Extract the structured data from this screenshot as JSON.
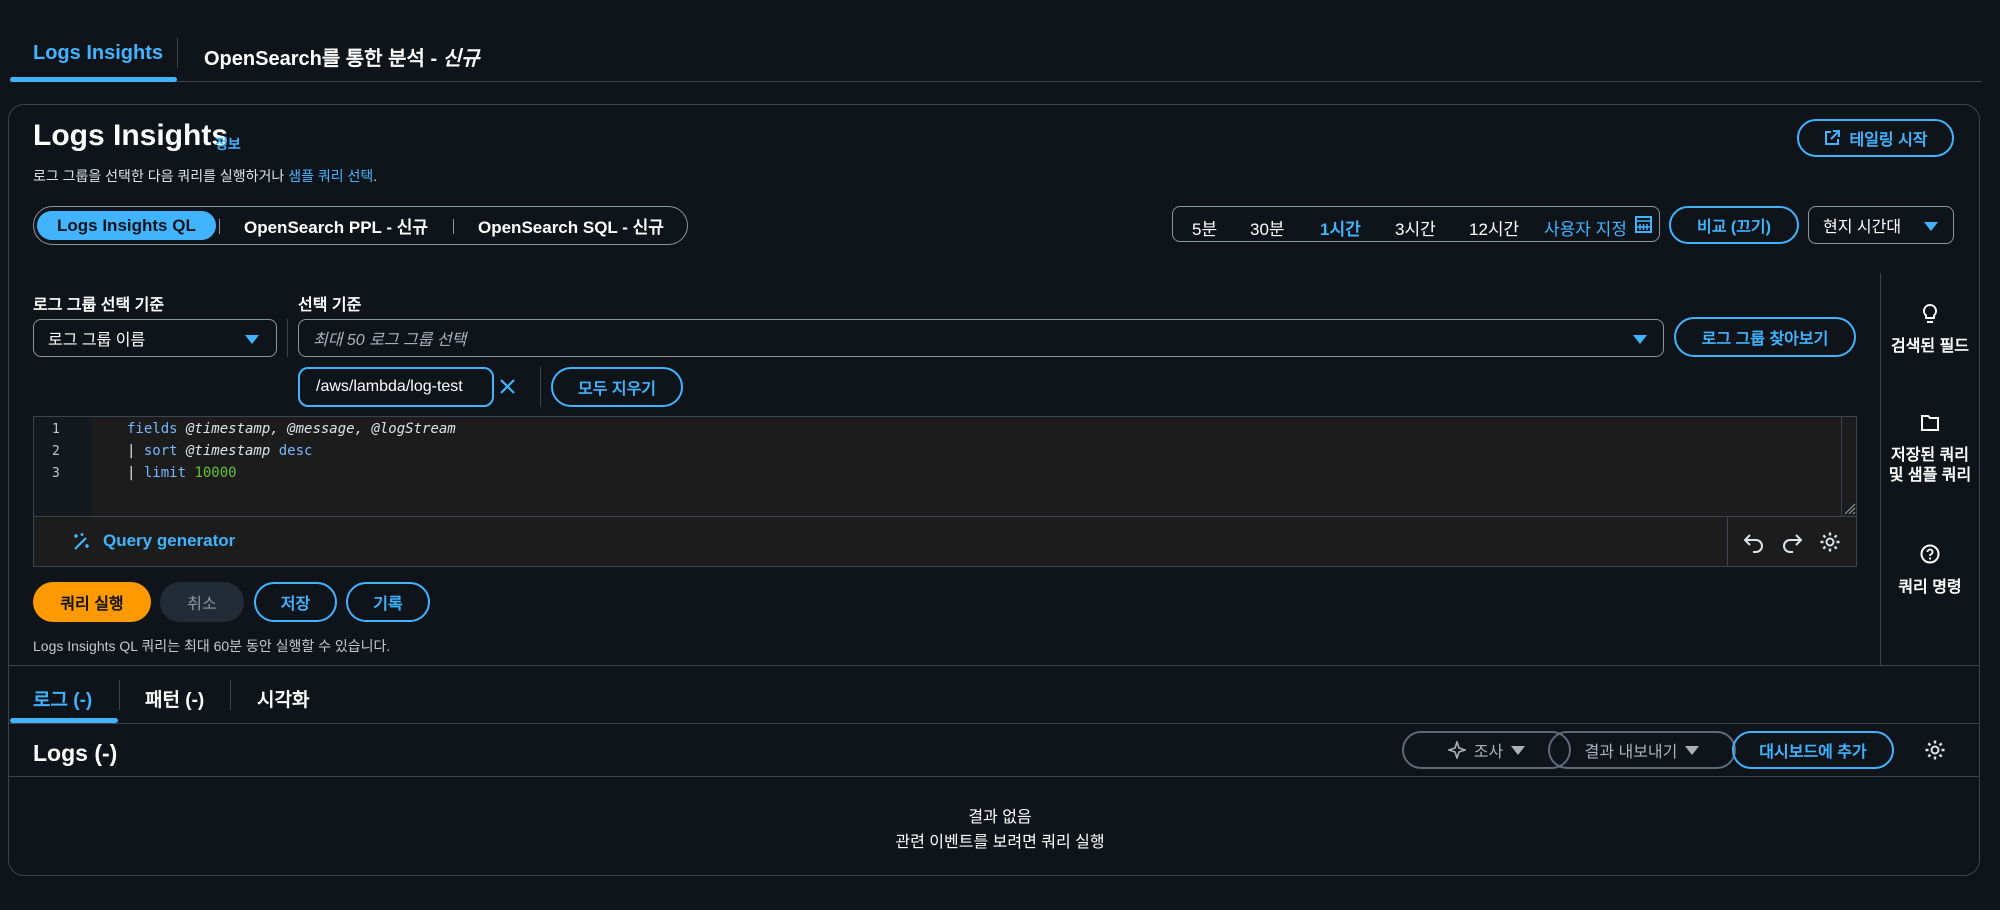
{
  "top_tabs": {
    "logs_insights": "Logs Insights",
    "opensearch_prefix": "OpenSearch를 통한 분석 - ",
    "opensearch_new": "신규"
  },
  "header": {
    "title": "Logs Insights",
    "info": "정보",
    "desc_prefix": "로그 그룹을 선택한 다음 쿼리를 실행하거나 ",
    "desc_link": "샘플 쿼리 선택",
    "desc_suffix": ".",
    "tail_button": "테일링 시작"
  },
  "query_language": {
    "items": [
      "Logs Insights QL",
      "OpenSearch PPL - 신규",
      "OpenSearch SQL - 신규"
    ],
    "selected": "Logs Insights QL"
  },
  "time_range": {
    "items": [
      "5분",
      "30분",
      "1시간",
      "3시간",
      "12시간"
    ],
    "selected": "1시간",
    "custom": "사용자 지정",
    "compare": "비교 (끄기)",
    "timezone": "현지 시간대"
  },
  "log_group": {
    "criteria_label": "로그 그룹 선택 기준",
    "criteria_value": "로그 그룹 이름",
    "select_label": "선택 기준",
    "select_placeholder": "최대 50 로그 그룹 선택",
    "browse_button": "로그 그룹 찾아보기",
    "token": "/aws/lambda/log-test",
    "clear_all": "모두 지우기"
  },
  "editor": {
    "line_numbers": [
      "1",
      "2",
      "3"
    ],
    "line1_kw": "fields",
    "line1_rest": " @timestamp, @message, @logStream",
    "line2_pipe": "| ",
    "line2_kw": "sort",
    "line2_mid": " @timestamp ",
    "line2_kw2": "desc",
    "line3_pipe": "| ",
    "line3_kw": "limit",
    "line3_num": " 10000",
    "query_generator": "Query generator"
  },
  "actions": {
    "run": "쿼리 실행",
    "cancel": "취소",
    "save": "저장",
    "history": "기록",
    "hint": "Logs Insights QL 쿼리는 최대 60분 동안 실행할 수 있습니다."
  },
  "side_panel": {
    "discovered_fields": "검색된 필드",
    "saved_queries_1": "저장된 쿼리",
    "saved_queries_2": "및 샘플 쿼리",
    "query_commands": "쿼리 명령"
  },
  "results": {
    "tabs": [
      "로그 (-)",
      "패턴 (-)",
      "시각화"
    ],
    "selected": "로그 (-)",
    "title": "Logs (-)",
    "investigate": "조사",
    "export": "결과 내보내기",
    "add_dashboard": "대시보드에 추가",
    "empty_title": "결과 없음",
    "empty_desc": "관련 이벤트를 보려면 쿼리 실행"
  },
  "colors": {
    "background": "#0f141a",
    "accent": "#42b4ff",
    "primary_button": "#ff9900",
    "border": "#3d4451"
  }
}
